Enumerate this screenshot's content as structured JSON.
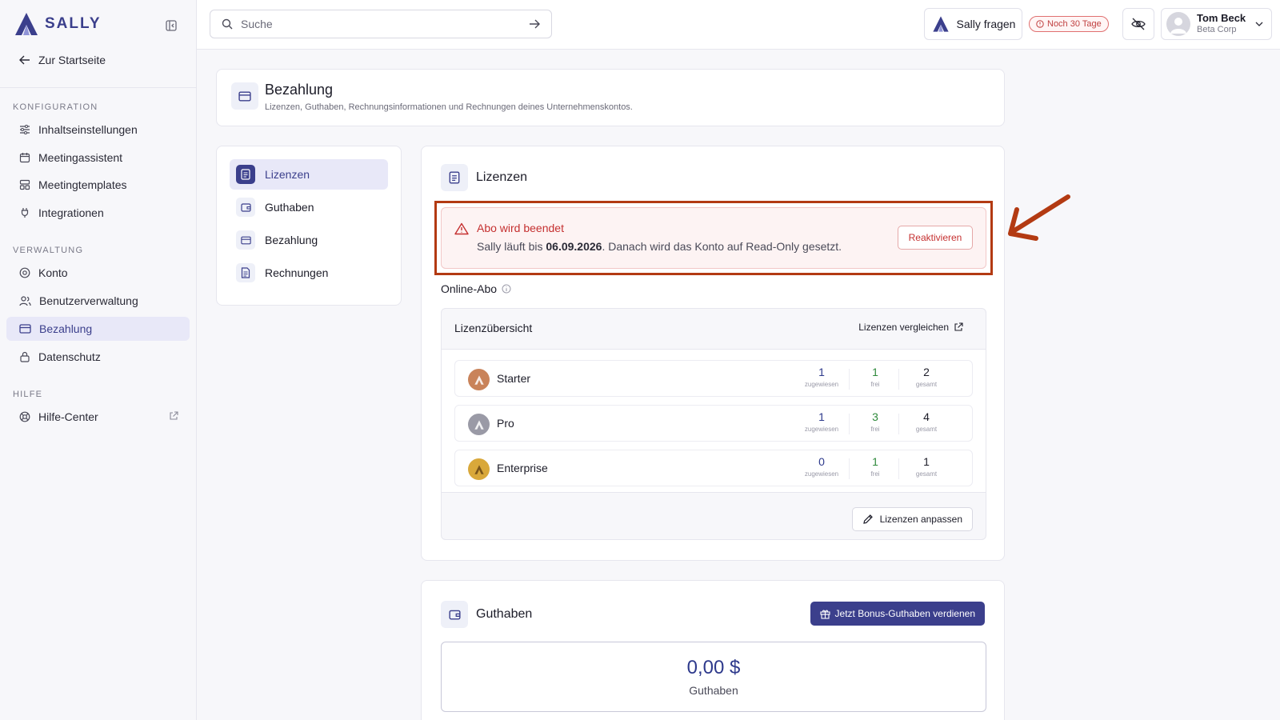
{
  "brand": {
    "name": "SALLY"
  },
  "sidebar": {
    "back_label": "Zur Startseite",
    "sections": [
      {
        "label": "KONFIGURATION",
        "items": [
          {
            "label": "Inhaltseinstellungen",
            "icon": "sliders-icon"
          },
          {
            "label": "Meetingassistent",
            "icon": "calendar-icon"
          },
          {
            "label": "Meetingtemplates",
            "icon": "template-icon"
          },
          {
            "label": "Integrationen",
            "icon": "plug-icon"
          }
        ]
      },
      {
        "label": "VERWALTUNG",
        "items": [
          {
            "label": "Konto",
            "icon": "at-icon"
          },
          {
            "label": "Benutzerverwaltung",
            "icon": "users-icon"
          },
          {
            "label": "Bezahlung",
            "icon": "credit-card-icon",
            "active": true
          },
          {
            "label": "Datenschutz",
            "icon": "lock-icon"
          }
        ]
      },
      {
        "label": "HILFE",
        "items": [
          {
            "label": "Hilfe-Center",
            "icon": "lifebuoy-icon",
            "external": true
          }
        ]
      }
    ]
  },
  "topbar": {
    "search_placeholder": "Suche",
    "ask_label": "Sally fragen",
    "trial_label": "Noch 30 Tage",
    "user": {
      "name": "Tom Beck",
      "company": "Beta Corp"
    }
  },
  "header": {
    "title": "Bezahlung",
    "subtitle": "Lizenzen, Guthaben, Rechnungsinformationen und Rechnungen deines Unternehmenskontos."
  },
  "subnav": [
    {
      "label": "Lizenzen",
      "active": true
    },
    {
      "label": "Guthaben"
    },
    {
      "label": "Bezahlung"
    },
    {
      "label": "Rechnungen"
    }
  ],
  "licenses": {
    "title": "Lizenzen",
    "alert": {
      "title": "Abo wird beendet",
      "text_before": "Sally läuft bis ",
      "date": "06.09.2026",
      "text_after": ". Danach wird das Konto auf Read-Only gesetzt.",
      "button": "Reaktivieren"
    },
    "plan_label": "Online-Abo",
    "overview_title": "Lizenzübersicht",
    "compare_label": "Lizenzen vergleichen",
    "stat_labels": {
      "assigned": "zugewiesen",
      "free": "frei",
      "total": "gesamt"
    },
    "rows": [
      {
        "name": "Starter",
        "assigned": "1",
        "free": "1",
        "total": "2",
        "color": "#c9835a"
      },
      {
        "name": "Pro",
        "assigned": "1",
        "free": "3",
        "total": "4",
        "color": "#9a9aa6"
      },
      {
        "name": "Enterprise",
        "assigned": "0",
        "free": "1",
        "total": "1",
        "color": "#d9a83a"
      }
    ],
    "adjust_label": "Lizenzen anpassen"
  },
  "credit": {
    "title": "Guthaben",
    "bonus_label": "Jetzt Bonus-Guthaben verdienen",
    "amount": "0,00 $",
    "amount_label": "Guthaben"
  },
  "colors": {
    "accent": "#3b3f8c",
    "alert_red": "#c53030",
    "annotation": "#b33a12"
  }
}
